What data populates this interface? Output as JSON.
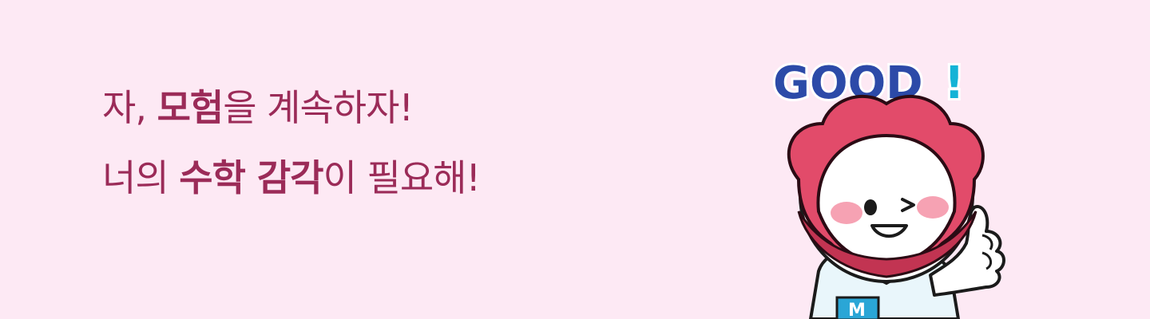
{
  "headline": {
    "line1": {
      "part1": "자, ",
      "part2": "모험",
      "part3": "을 계속하자!"
    },
    "line2": {
      "part1": "너의 ",
      "part2": "수학 감각",
      "part3": "이 필요해!"
    }
  },
  "mascot": {
    "badge_text": "GOOD",
    "badge_exclaim": "!",
    "shirt_logo": "M",
    "colors": {
      "petal": "#e24b6a",
      "petal_outline": "#2b0b14",
      "face": "#ffffff",
      "cheek": "#f6a2b3",
      "good_blue": "#2c4aa8",
      "good_cyan": "#14b3d6",
      "shirt": "#e9f6fb",
      "shirt_accent": "#2aa6d6"
    }
  }
}
